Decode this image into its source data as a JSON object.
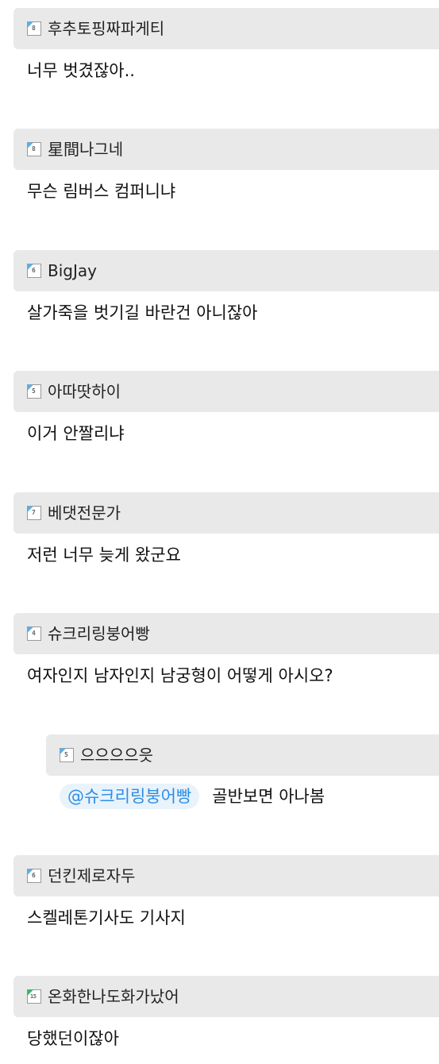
{
  "comments": [
    {
      "level": "8",
      "level_color": "#5ab0e8",
      "nickname": "후추토핑짜파게티",
      "text": "너무 벗겼잖아.."
    },
    {
      "level": "8",
      "level_color": "#5ab0e8",
      "nickname": "星間나그네",
      "text": "무슨 림버스 컴퍼니냐"
    },
    {
      "level": "6",
      "level_color": "#5ab0e8",
      "nickname": "BigJay",
      "text": "살가죽을 벗기길 바란건 아니잖아"
    },
    {
      "level": "5",
      "level_color": "#5ab0e8",
      "nickname": "아따땃하이",
      "text": "이거 안짤리냐"
    },
    {
      "level": "7",
      "level_color": "#5ab0e8",
      "nickname": "베댓전문가",
      "text": "저런 너무 늦게 왔군요"
    },
    {
      "level": "4",
      "level_color": "#5ab0e8",
      "nickname": "슈크리링붕어빵",
      "text": "여자인지 남자인지 남궁형이 어떻게 아시오?"
    },
    {
      "level": "5",
      "level_color": "#5ab0e8",
      "nickname": "으으으으읏",
      "mention": "@슈크리링붕어빵",
      "text": "골반보면 아나봄"
    },
    {
      "level": "6",
      "level_color": "#5ab0e8",
      "nickname": "던킨제로자두",
      "text": "스켈레톤기사도 기사지"
    },
    {
      "level": "15",
      "level_color": "#3cb371",
      "nickname": "온화한나도화가났어",
      "text": "당했던이잖아"
    }
  ]
}
